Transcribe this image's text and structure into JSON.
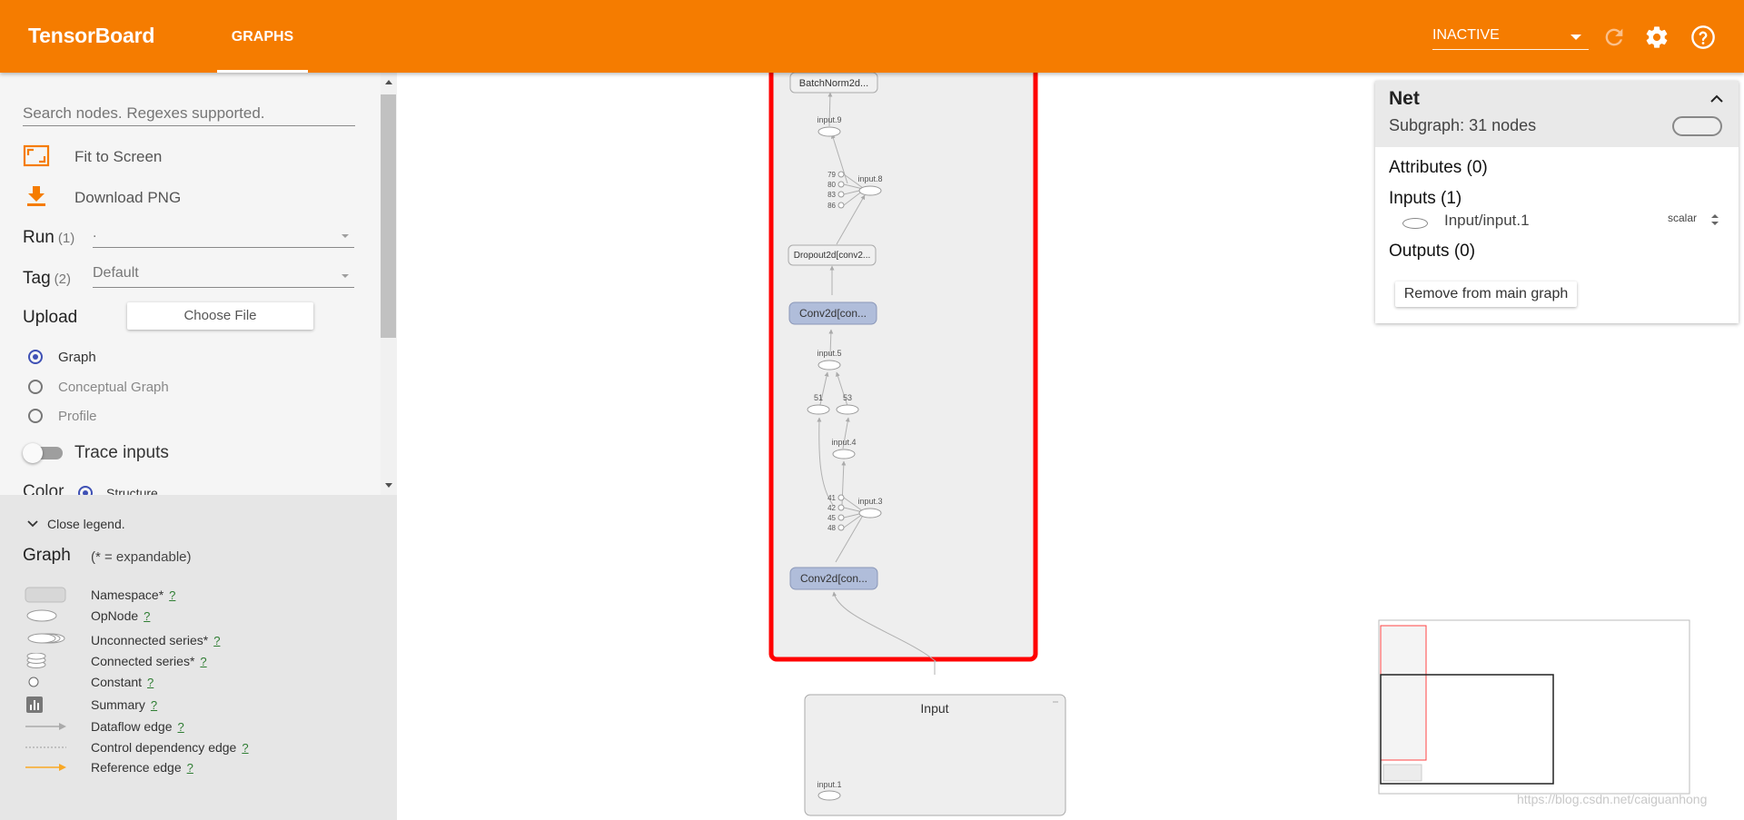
{
  "app": {
    "title": "TensorBoard",
    "tabs": [
      {
        "label": "GRAPHS"
      }
    ]
  },
  "toolbar": {
    "run_select_value": "INACTIVE",
    "icons": [
      "refresh-icon",
      "settings-gear-icon",
      "help-icon"
    ]
  },
  "colors": {
    "brand": "#f57c00",
    "selection": "#ff0000",
    "series_node": "#b0bdda",
    "radio_accent": "#3f51b5",
    "reference_edge": "#f9a825"
  },
  "sidebar": {
    "search_placeholder": "Search nodes. Regexes supported.",
    "fit_to_screen": "Fit to Screen",
    "download_png": "Download PNG",
    "run": {
      "label": "Run",
      "count": "(1)",
      "value": "."
    },
    "tag": {
      "label": "Tag",
      "count": "(2)",
      "value": "Default"
    },
    "upload": {
      "label": "Upload",
      "button": "Choose File"
    },
    "graph_types": [
      {
        "label": "Graph",
        "selected": true
      },
      {
        "label": "Conceptual Graph",
        "selected": false
      },
      {
        "label": "Profile",
        "selected": false
      }
    ],
    "trace_inputs": "Trace inputs",
    "color": {
      "label": "Color",
      "option": "Structure"
    }
  },
  "legend": {
    "close": "Close legend.",
    "title": "Graph",
    "subtitle": "(* = expandable)",
    "help": "?",
    "items": [
      {
        "label": "Namespace*",
        "icon": "namespace-icon"
      },
      {
        "label": "OpNode",
        "icon": "opnode-icon"
      },
      {
        "label": "Unconnected series*",
        "icon": "unconnected-series-icon"
      },
      {
        "label": "Connected series*",
        "icon": "connected-series-icon"
      },
      {
        "label": "Constant",
        "icon": "constant-icon"
      },
      {
        "label": "Summary",
        "icon": "summary-icon"
      },
      {
        "label": "Dataflow edge",
        "icon": "dataflow-edge-icon"
      },
      {
        "label": "Control dependency edge",
        "icon": "control-edge-icon"
      },
      {
        "label": "Reference edge",
        "icon": "reference-edge-icon"
      }
    ]
  },
  "graph": {
    "nodes": {
      "batchnorm": "BatchNorm2d...",
      "input9": "input.9",
      "input8": "input.8",
      "c79": "79",
      "c80": "80",
      "c83": "83",
      "c86": "86",
      "dropout": "Dropout2d[conv2...",
      "conv_top": "Conv2d[con...",
      "input5": "input.5",
      "n51": "51",
      "n53": "53",
      "input4": "input.4",
      "c41": "41",
      "c42": "42",
      "c45": "45",
      "c48": "48",
      "input3": "input.3",
      "conv_bottom": "Conv2d[con...",
      "input_ns": "Input",
      "input1": "input.1"
    }
  },
  "info_card": {
    "name": "Net",
    "subgraph": "Subgraph: 31 nodes",
    "attributes": "Attributes (0)",
    "inputs": "Inputs (1)",
    "input_name": "Input/input.1",
    "input_type": "scalar",
    "outputs": "Outputs (0)",
    "remove_button": "Remove from main graph"
  },
  "watermark": "https://blog.csdn.net/caiguanhong"
}
